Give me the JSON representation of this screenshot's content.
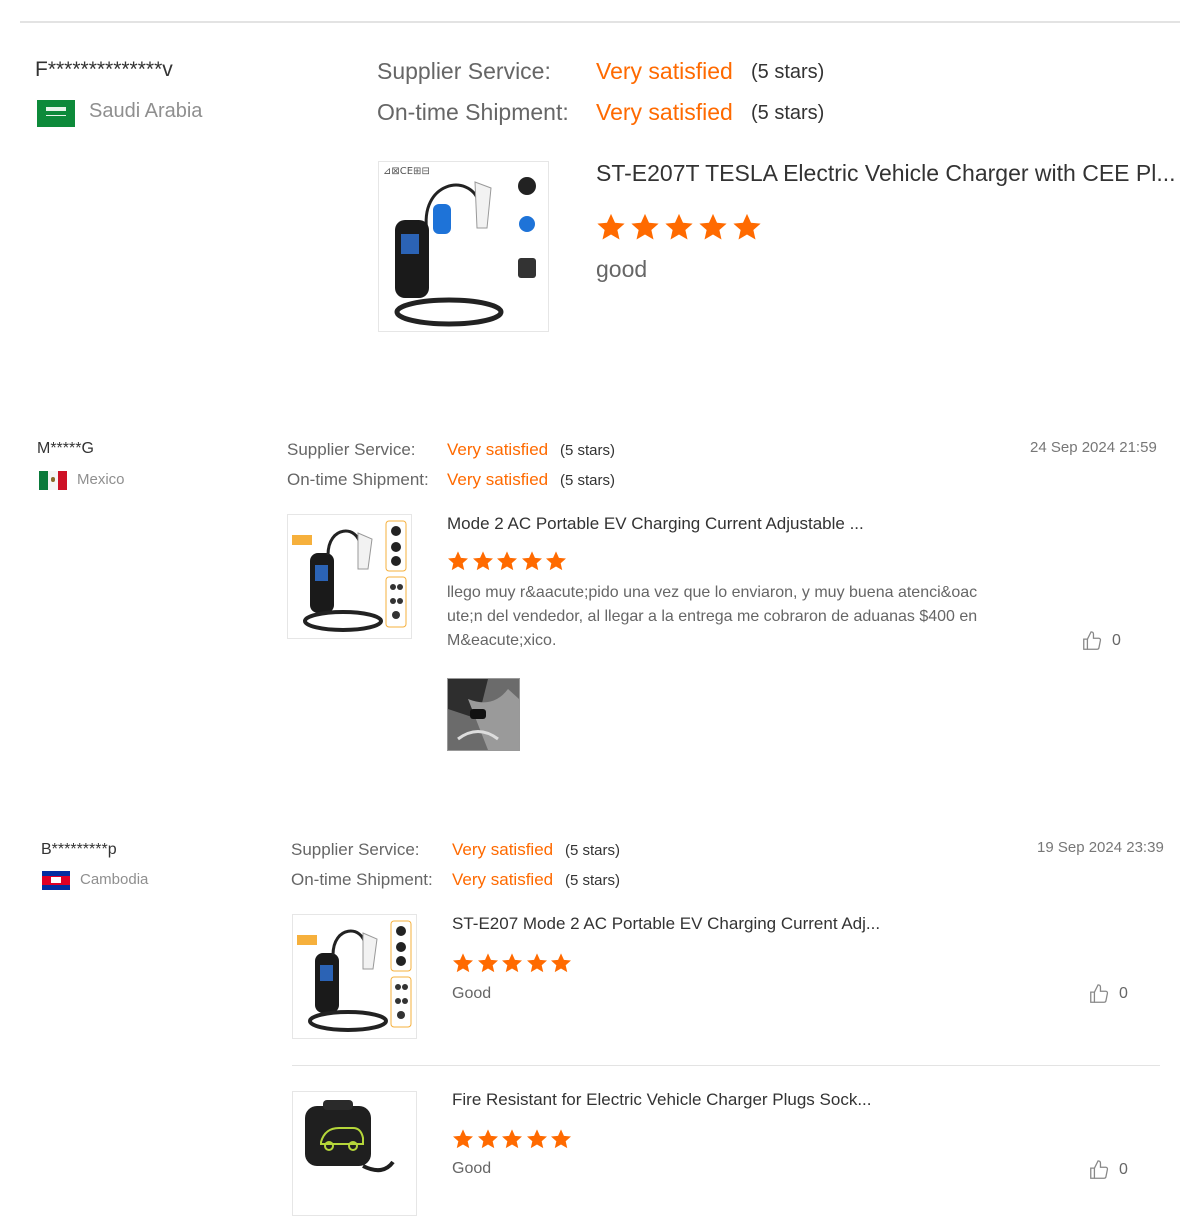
{
  "review1": {
    "user": "F**************v",
    "country": "Saudi Arabia",
    "supplier_label": "Supplier Service:",
    "supplier_value": "Very satisfied",
    "supplier_stars": "(5 stars)",
    "shipment_label": "On-time Shipment:",
    "shipment_value": "Very satisfied",
    "shipment_stars": "(5 stars)",
    "product_title": "ST-E207T TESLA Electric Vehicle Charger with CEE Pl...",
    "rating": 5,
    "text": "good"
  },
  "review2": {
    "user": "M*****G",
    "country": "Mexico",
    "date": "24 Sep 2024 21:59",
    "supplier_label": "Supplier Service:",
    "supplier_value": "Very satisfied",
    "supplier_stars": "(5 stars)",
    "shipment_label": "On-time Shipment:",
    "shipment_value": "Very satisfied",
    "shipment_stars": "(5 stars)",
    "product_title": "Mode 2 AC Portable EV Charging Current Adjustable ...",
    "rating": 5,
    "text_line1": "llego muy r&aacute;pido una vez que lo enviaron, y muy buena atenci&oac",
    "text_line2": "ute;n del vendedor, al llegar a la entrega me cobraron de aduanas $400 en",
    "text_line3": "M&eacute;xico.",
    "likes": "0"
  },
  "review3": {
    "user": "B*********p",
    "country": "Cambodia",
    "date": "19 Sep 2024 23:39",
    "supplier_label": "Supplier Service:",
    "supplier_value": "Very satisfied",
    "supplier_stars": "(5 stars)",
    "shipment_label": "On-time Shipment:",
    "shipment_value": "Very satisfied",
    "shipment_stars": "(5 stars)",
    "items": [
      {
        "product_title": "ST-E207 Mode 2 AC Portable EV Charging Current Adj...",
        "rating": 5,
        "text": "Good",
        "likes": "0"
      },
      {
        "product_title": "Fire Resistant for Electric Vehicle Charger Plugs Sock...",
        "rating": 5,
        "text": "Good",
        "likes": "0"
      }
    ]
  },
  "colors": {
    "accent": "#ff6a00",
    "star": "#ff6a00"
  },
  "icons": {
    "like": "thumbs-up-icon",
    "star": "star-icon"
  }
}
